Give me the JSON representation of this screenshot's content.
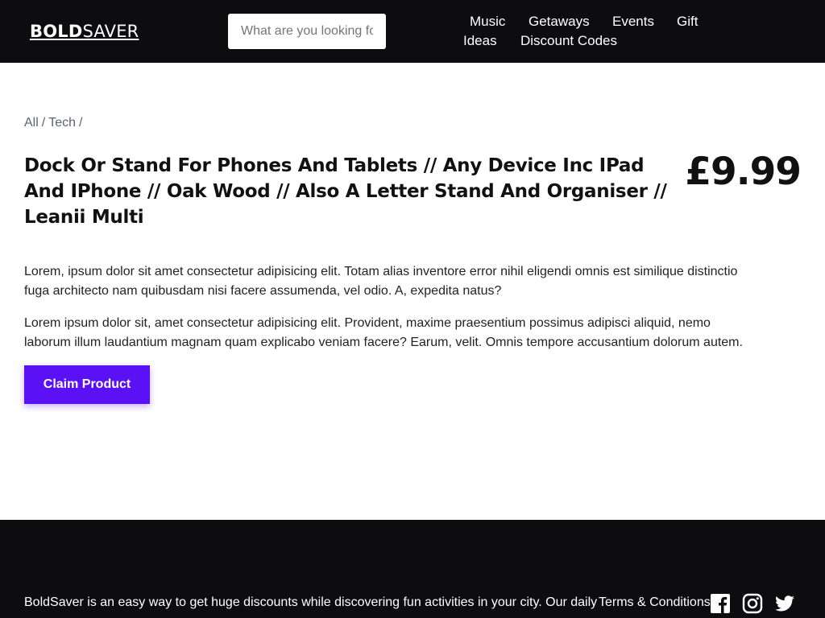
{
  "header": {
    "logo_bold": "BOLD",
    "logo_light": "SAVER",
    "search_placeholder": "What are you looking for?",
    "nav": [
      "Music",
      "Getaways",
      "Events",
      "Gift",
      "Ideas",
      "Discount Codes"
    ]
  },
  "breadcrumb": {
    "items": [
      "All",
      "Tech"
    ],
    "separator": "/"
  },
  "product": {
    "title": "Dock Or Stand For Phones And Tablets // Any Device Inc IPad And IPhone // Oak Wood // Also A Letter Stand And Organiser // Leanii Multi",
    "price": "£9.99",
    "description": [
      "Lorem, ipsum dolor sit amet consectetur adipisicing elit. Totam alias inventore error nihil eligendi omnis est similique distinctio fuga architecto nam quibusdam nisi facere assumenda, vel odio. A, expedita natus?",
      "Lorem ipsum dolor sit, amet consectetur adipisicing elit. Provident, maxime praesentium possimus adipisci aliquid, nemo laborum illum laudantium magnam quam explicabo veniam facere? Earum, velit. Omnis tempore accusantium dolorum autem."
    ],
    "claim_label": "Claim Product"
  },
  "footer": {
    "about": "BoldSaver is an easy way to get huge discounts while discovering fun activities in your city. Our daily",
    "terms_label": "Terms & Conditions",
    "social": [
      "facebook-icon",
      "instagram-icon",
      "twitter-icon"
    ]
  },
  "colors": {
    "header_bg": "#0d0c0f",
    "accent": "#5a12f4",
    "footer_bg": "#0d0c0f"
  }
}
